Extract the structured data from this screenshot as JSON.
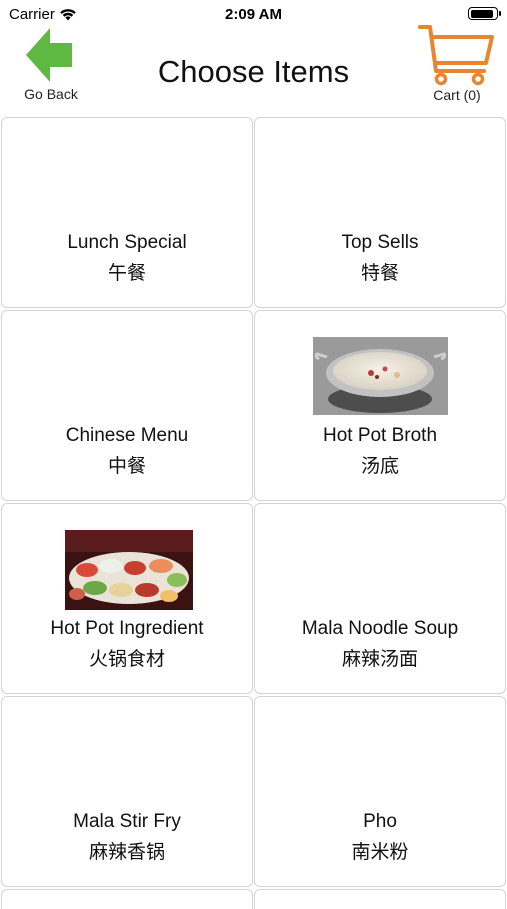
{
  "status_bar": {
    "carrier": "Carrier",
    "time": "2:09 AM"
  },
  "nav": {
    "back_label": "Go Back",
    "title": "Choose Items",
    "cart_label": "Cart (0)",
    "back_arrow_color": "#5fb841",
    "cart_color": "#e8862f"
  },
  "categories": [
    {
      "name": "Lunch Special",
      "name_cn": "午餐",
      "image": null
    },
    {
      "name": "Top Sells",
      "name_cn": "特餐",
      "image": null
    },
    {
      "name": "Chinese Menu",
      "name_cn": "中餐",
      "image": null
    },
    {
      "name": "Hot Pot Broth",
      "name_cn": "汤底",
      "image": "hot-pot-broth-photo"
    },
    {
      "name": "Hot Pot Ingredient",
      "name_cn": "火锅食材",
      "image": "hot-pot-ingredient-photo"
    },
    {
      "name": "Mala Noodle Soup",
      "name_cn": "麻辣汤面",
      "image": null
    },
    {
      "name": "Mala Stir Fry",
      "name_cn": "麻辣香锅",
      "image": null
    },
    {
      "name": "Pho",
      "name_cn": "南米粉",
      "image": null
    }
  ]
}
